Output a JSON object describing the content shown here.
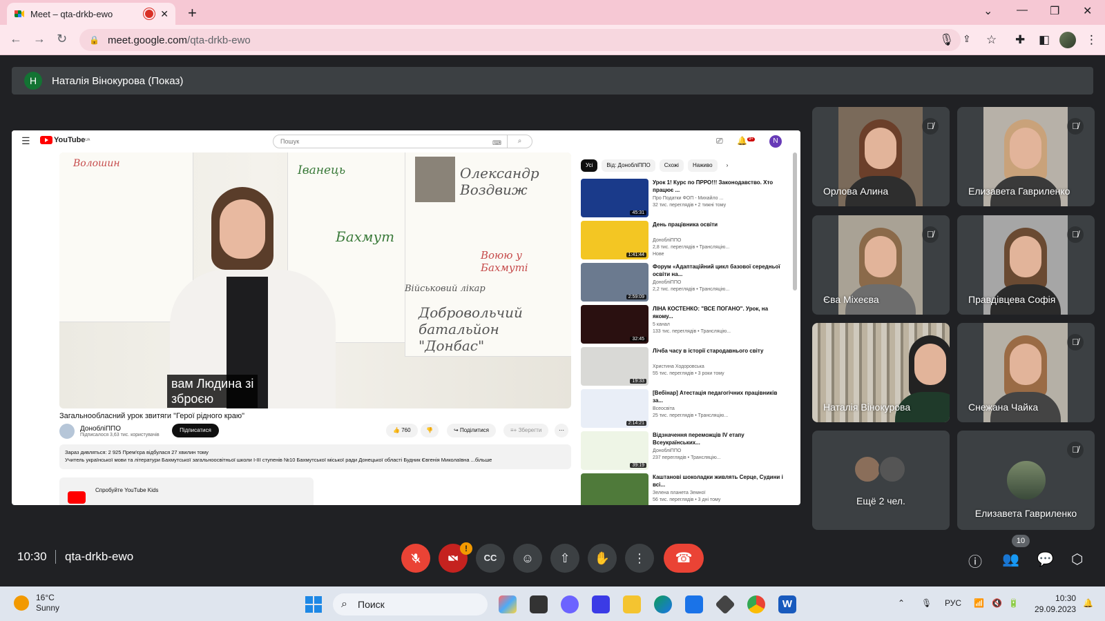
{
  "browser": {
    "tab_title": "Meet – qta-drkb-ewo",
    "url_host": "meet.google.com",
    "url_path": "/qta-drkb-ewo"
  },
  "meet": {
    "presenter_initial": "Н",
    "presenter_label": "Наталія Вінокурова (Показ)",
    "time": "10:30",
    "meeting_code": "qta-drkb-ewo",
    "participant_count": "10",
    "camera_warning": "!",
    "tiles": [
      {
        "name": "Орлова Алина",
        "muted": true
      },
      {
        "name": "Елизавета Гавриленко",
        "muted": true
      },
      {
        "name": "Єва Міхеєва",
        "muted": true
      },
      {
        "name": "Правдівцева Софія",
        "muted": true
      },
      {
        "name": "Наталія Вінокурова",
        "muted": false
      },
      {
        "name": "Снежана Чайка",
        "muted": true
      },
      {
        "name": "Ещё 2 чел.",
        "muted": false
      },
      {
        "name": "Елизавета Гавриленко",
        "muted": true
      }
    ]
  },
  "youtube": {
    "logo_text": "YouTube",
    "logo_region": "UA",
    "search_placeholder": "Пошук",
    "avatar_initial": "N",
    "notif_count": "9+",
    "subtitle_line1": "вам Людина зі",
    "subtitle_line2": "зброєю",
    "video_title": "Загальнообласний урок звитяги \"Герої рідного краю\"",
    "channel_name": "ДонобліППО",
    "channel_subs": "Підписалося 3,63 тис. користувачів",
    "subscribe_label": "Підписатися",
    "likes": "760",
    "share_label": "Поділитися",
    "save_label": "Зберегти",
    "desc_line1": "Зараз дивляться: 2 925  Прем'єра відбулася 27 хвилин тому",
    "desc_line2": "Учитель української мови та літератури Бахмутської загальноосвітньої школи І-ІІІ ступенів №10 Бахмутської міської ради Донецької області Будник Євгенія Миколаївна ...більше",
    "kids_label": "Спробуйте YouTube Kids",
    "board_texts": [
      "Олександр Воздвиж",
      "Волошин",
      "Іванець",
      "Бахмут",
      "Воюю у Бахмуті",
      "Військовий лікар",
      "Добровольчий батальйон \"Донбас\""
    ],
    "chips": [
      "Усі",
      "Від: ДонобліППО",
      "Схожі",
      "Наживо"
    ],
    "recs": [
      {
        "title": "Урок 1! Курс по ПРРО!!! Законодавство. Хто працює ...",
        "meta1": "Про Податки ФОП - Михайло ...",
        "meta2": "32 тис. переглядів • 2 тижні тому",
        "duration": "45:31",
        "color": "#1a3a8a"
      },
      {
        "title": "День працівника освіти",
        "meta1": "ДонобліППО",
        "meta2": "2,8 тис. переглядів • Трансляцію...",
        "meta3": "Нове",
        "duration": "1:41:44",
        "color": "#f3c623"
      },
      {
        "title": "Форум «Адаптаційний цикл базової середньої освіти на...",
        "meta1": "ДонобліППО",
        "meta2": "2,2 тис. переглядів • Трансляцію...",
        "duration": "2:59:09",
        "color": "#6b7a8f"
      },
      {
        "title": "ЛІНА КОСТЕНКО: \"ВСЕ ПОГАНО\". Урок, на якому...",
        "meta1": "5 канал",
        "meta2": "133 тис. переглядів • Трансляцію...",
        "duration": "32:45",
        "color": "#2a1010"
      },
      {
        "title": "Лічба часу в історії стародавнього світу",
        "meta1": "Христина Ходоровська",
        "meta2": "55 тис. переглядів • 3 роки тому",
        "duration": "19:33",
        "color": "#d9d9d6"
      },
      {
        "title": "[Вебінар] Атестація педагогічних працівників за...",
        "meta1": "Всеосвіта",
        "meta2": "25 тис. переглядів • Трансляцію...",
        "duration": "2:14:21",
        "color": "#e9eef7"
      },
      {
        "title": "Відзначення переможців IV етапу Всеукраїнських...",
        "meta1": "ДонобліППО",
        "meta2": "237 переглядів • Трансляцію...",
        "duration": "39:19",
        "color": "#eef5e6"
      },
      {
        "title": "Каштанові шоколадки живлять Серце, Судини і всі...",
        "meta1": "Зелена планета Земної",
        "meta2": "56 тис. переглядів • 3 дні тому",
        "duration": "",
        "color": "#4f7a3a"
      }
    ]
  },
  "taskbar": {
    "temp": "16°C",
    "weather": "Sunny",
    "search": "Поиск",
    "lang": "РУС",
    "clock_time": "10:30",
    "clock_date": "29.09.2023"
  }
}
